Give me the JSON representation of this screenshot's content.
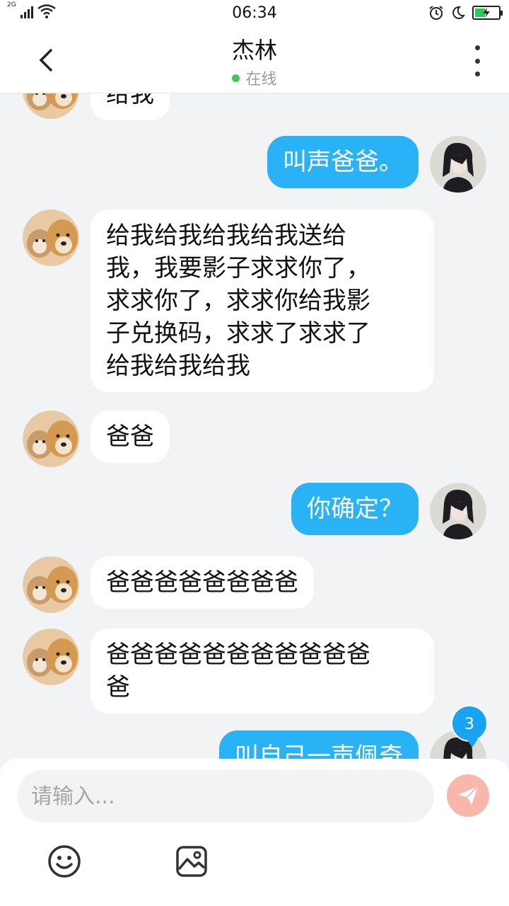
{
  "status_bar": {
    "network": "2G",
    "time": "06:34"
  },
  "header": {
    "title": "杰林",
    "status": "在线"
  },
  "messages": [
    {
      "side": "left",
      "text": "给我"
    },
    {
      "side": "right",
      "text": "叫声爸爸。"
    },
    {
      "side": "left",
      "lines": [
        "给我给我给我给我送给",
        "我，我要影子求求你了，",
        "求求你了，求求你给我影",
        "子兑换码，求求了求求了",
        "给我给我给我"
      ]
    },
    {
      "side": "left",
      "text": "爸爸"
    },
    {
      "side": "right",
      "text": "你确定？"
    },
    {
      "side": "left",
      "text": "爸爸爸爸爸爸爸爸"
    },
    {
      "side": "left",
      "lines": [
        "爸爸爸爸爸爸爸爸爸爸爸",
        "爸"
      ]
    },
    {
      "side": "right",
      "text": "叫自己一声佩奇"
    }
  ],
  "unread_badge": "3",
  "composer": {
    "placeholder": "请输入..."
  },
  "icons": {
    "back": "chevron-left-icon",
    "more": "more-vertical-icon",
    "send": "send-icon",
    "emoji": "smiley-icon",
    "image": "image-icon"
  },
  "colors": {
    "accent": "#29b2f6",
    "online": "#3cc85a",
    "send_button": "#f9b7ab",
    "badge": "#1aa3f2"
  }
}
